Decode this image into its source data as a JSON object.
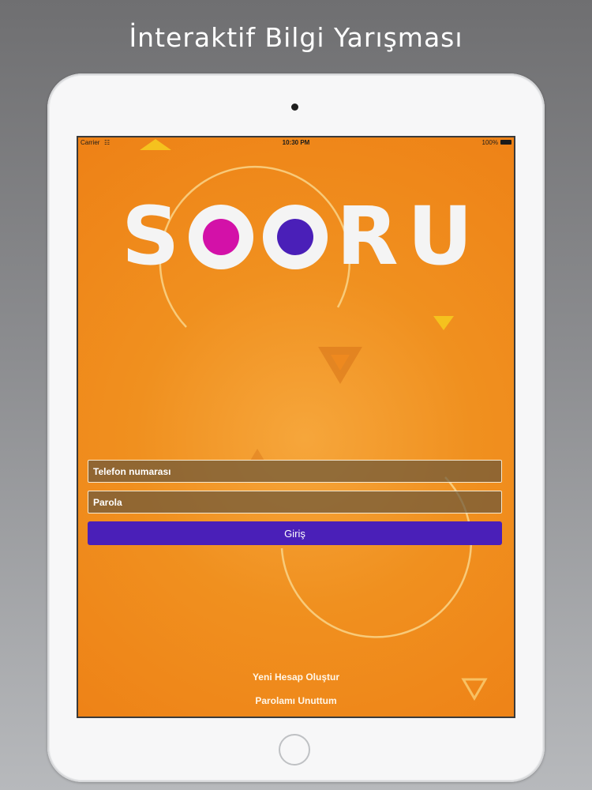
{
  "headline": "İnteraktif Bilgi Yarışması",
  "status_bar": {
    "carrier": "Carrier",
    "wifi_icon": "wifi-icon",
    "time": "10:30 PM",
    "battery": "100%",
    "battery_icon": "battery-icon"
  },
  "logo": {
    "letter_s": "S",
    "letter_r": "R",
    "letter_u": "U",
    "dot_color_1": "#d311a8",
    "dot_color_2": "#4a1fb8"
  },
  "login_form": {
    "phone_placeholder": "Telefon numarası",
    "password_placeholder": "Parola",
    "login_label": "Giriş"
  },
  "links": {
    "create_account": "Yeni Hesap Oluştur",
    "forgot_password": "Parolamı Unuttum"
  },
  "colors": {
    "background_orange": "#f0901f",
    "button_purple": "#4a1fb8",
    "logo_white": "#f4f4f4"
  }
}
